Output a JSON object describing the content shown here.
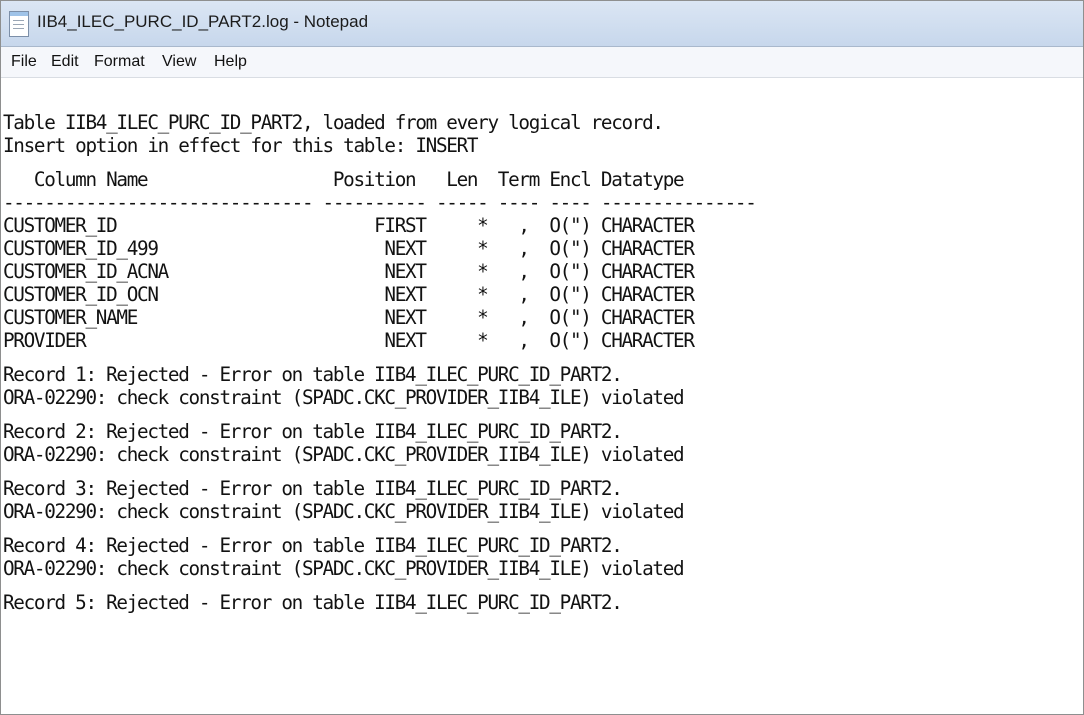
{
  "window": {
    "title": "IIB4_ILEC_PURC_ID_PART2.log - Notepad"
  },
  "menu": {
    "items": [
      "File",
      "Edit",
      "Format",
      "View",
      "Help"
    ]
  },
  "log": {
    "lines": [
      "Table IIB4_ILEC_PURC_ID_PART2, loaded from every logical record.",
      "Insert option in effect for this table: INSERT",
      "",
      "   Column Name                  Position   Len  Term Encl Datatype",
      "------------------------------ ---------- ----- ---- ---- ---------------",
      "CUSTOMER_ID                         FIRST     *   ,  O(\") CHARACTER",
      "CUSTOMER_ID_499                      NEXT     *   ,  O(\") CHARACTER",
      "CUSTOMER_ID_ACNA                     NEXT     *   ,  O(\") CHARACTER",
      "CUSTOMER_ID_OCN                      NEXT     *   ,  O(\") CHARACTER",
      "CUSTOMER_NAME                        NEXT     *   ,  O(\") CHARACTER",
      "PROVIDER                             NEXT     *   ,  O(\") CHARACTER",
      "",
      "Record 1: Rejected - Error on table IIB4_ILEC_PURC_ID_PART2.",
      "ORA-02290: check constraint (SPADC.CKC_PROVIDER_IIB4_ILE) violated",
      "",
      "Record 2: Rejected - Error on table IIB4_ILEC_PURC_ID_PART2.",
      "ORA-02290: check constraint (SPADC.CKC_PROVIDER_IIB4_ILE) violated",
      "",
      "Record 3: Rejected - Error on table IIB4_ILEC_PURC_ID_PART2.",
      "ORA-02290: check constraint (SPADC.CKC_PROVIDER_IIB4_ILE) violated",
      "",
      "Record 4: Rejected - Error on table IIB4_ILEC_PURC_ID_PART2.",
      "ORA-02290: check constraint (SPADC.CKC_PROVIDER_IIB4_ILE) violated",
      "",
      "Record 5: Rejected - Error on table IIB4_ILEC_PURC_ID_PART2."
    ]
  }
}
